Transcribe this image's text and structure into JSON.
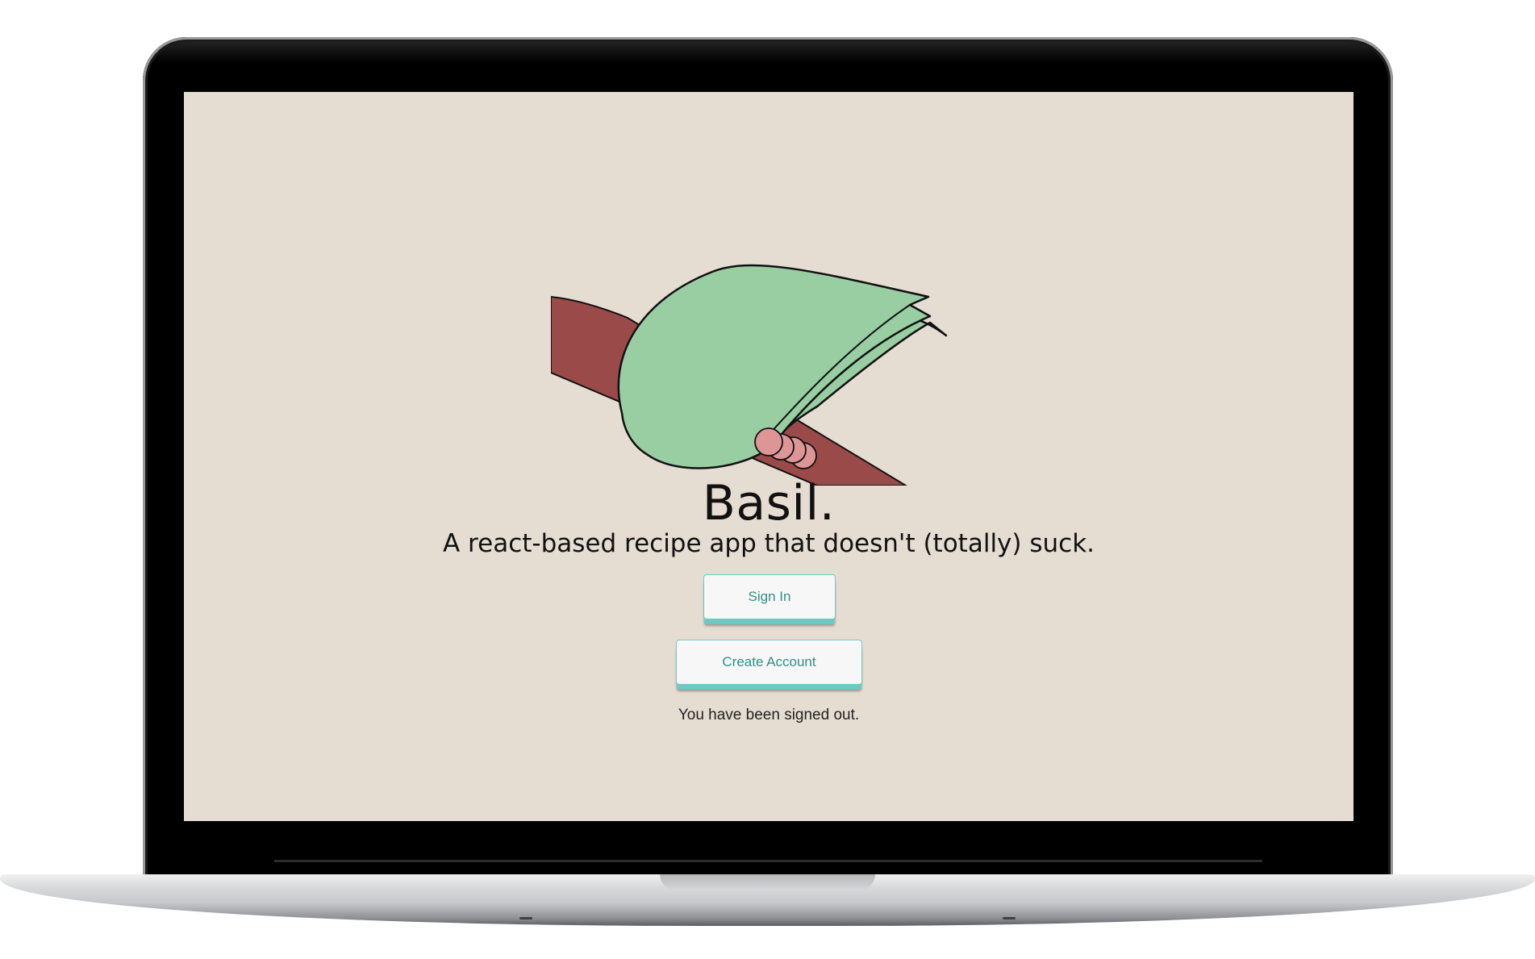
{
  "app": {
    "title": "Basil.",
    "tagline": "A react-based recipe app that doesn't (totally) suck."
  },
  "actions": {
    "sign_in_label": "Sign In",
    "create_account_label": "Create Account"
  },
  "status": {
    "message": "You have been signed out."
  },
  "illustration": {
    "icon": "basil-leaf-on-branch-illustration",
    "colors": {
      "leaf": "#99cea3",
      "branch": "#9b4a4a",
      "berries": "#dd9595",
      "outline": "#111111"
    }
  },
  "theme": {
    "background": "#e6ddd2",
    "accent": "#6fc9c3",
    "button_text": "#2f8f89"
  }
}
